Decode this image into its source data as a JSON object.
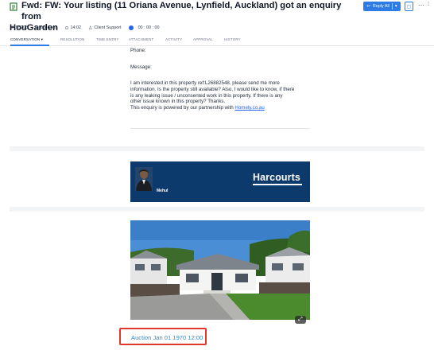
{
  "ticket": {
    "title_line1": "Fwd: FW: Your listing (11 Oriana Avenue, Lynfield, Auckland) got an enquiry from",
    "title_line2": "HouGarden",
    "id": "#155203",
    "agent": "Cathy Chen",
    "time": "14:02",
    "group": "Client Support",
    "timer": "00 : 00 : 00"
  },
  "actions": {
    "reply_label": "Reply All",
    "dropdown_icon": "chevron-down-icon",
    "comment_icon": "comment-icon",
    "more_icon": "more-icon"
  },
  "tabs": [
    {
      "label": "Conversation",
      "active": true
    },
    {
      "label": "Resolution"
    },
    {
      "label": "Time Entry"
    },
    {
      "label": "Attachment"
    },
    {
      "label": "Activity"
    },
    {
      "label": "Approval"
    },
    {
      "label": "History"
    }
  ],
  "email": {
    "phone_label": "Phone:",
    "message_label": "Message:",
    "message_lines": [
      "I am interested in this property ref:L26882548, please send me more",
      "information. Is the property still available? Also, I would like to know, if there",
      "is any leaking issue / unconsented work in this property. If there is any",
      "other issue known in this property? Thanks."
    ],
    "powered_prefix": "This enquiry is powered by our partnership with ",
    "powered_link": "Homely.co.au",
    "banner_agent": "Mehul",
    "banner_brand": "Harcourts",
    "auction_text": "Auction Jan 01 1970 12:00"
  },
  "colors": {
    "accent": "#2d7be5",
    "banner": "#0d3a6c",
    "highlight": "#e0392b",
    "link": "#2d8ad6"
  }
}
